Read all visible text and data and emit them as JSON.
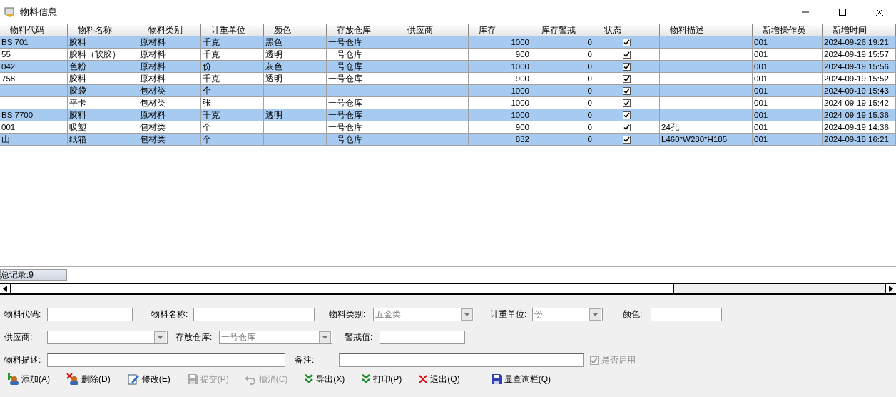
{
  "window": {
    "title": "物料信息"
  },
  "table": {
    "columns": [
      {
        "label": "物料代码",
        "kind": "text"
      },
      {
        "label": "物料名称",
        "kind": "text"
      },
      {
        "label": "物料类别",
        "kind": "text"
      },
      {
        "label": "计重单位",
        "kind": "text"
      },
      {
        "label": "颜色",
        "kind": "text"
      },
      {
        "label": "存放仓库",
        "kind": "text"
      },
      {
        "label": "供应商",
        "kind": "text"
      },
      {
        "label": "库存",
        "kind": "number"
      },
      {
        "label": "库存警戒",
        "kind": "number"
      },
      {
        "label": "状态",
        "kind": "check"
      },
      {
        "label": "物料描述",
        "kind": "text"
      },
      {
        "label": "新增操作员",
        "kind": "text"
      },
      {
        "label": "新增时间",
        "kind": "text"
      }
    ],
    "rows": [
      {
        "cells": [
          {
            "text": "BS 701"
          },
          {
            "text": "胶料"
          },
          {
            "text": "原材料"
          },
          {
            "text": "千克"
          },
          {
            "text": "黑色"
          },
          {
            "text": "一号仓库"
          },
          {},
          {
            "text": "1000"
          },
          {
            "text": "0"
          },
          {
            "checked": true
          },
          {},
          {
            "text": "001"
          },
          {
            "text": "2024-09-26 19:21"
          }
        ]
      },
      {
        "cells": [
          {
            "text": "55"
          },
          {
            "text": "胶料（软胶）"
          },
          {
            "text": "原材料"
          },
          {
            "text": "千克"
          },
          {
            "text": "透明"
          },
          {
            "text": "一号仓库"
          },
          {},
          {
            "text": "900"
          },
          {
            "text": "0"
          },
          {
            "checked": true
          },
          {},
          {
            "text": "001"
          },
          {
            "text": "2024-09-19 15:57"
          }
        ]
      },
      {
        "cells": [
          {
            "text": "042"
          },
          {
            "text": "色粉"
          },
          {
            "text": "原材料"
          },
          {
            "text": "份"
          },
          {
            "text": "灰色"
          },
          {
            "text": "一号仓库"
          },
          {},
          {
            "text": "1000"
          },
          {
            "text": "0"
          },
          {
            "checked": true
          },
          {},
          {
            "text": "001"
          },
          {
            "text": "2024-09-19 15:56"
          }
        ]
      },
      {
        "cells": [
          {
            "text": "758"
          },
          {
            "text": "胶料"
          },
          {
            "text": "原材料"
          },
          {
            "text": "千克"
          },
          {
            "text": "透明"
          },
          {
            "text": "一号仓库"
          },
          {},
          {
            "text": "900"
          },
          {
            "text": "0"
          },
          {
            "checked": true
          },
          {},
          {
            "text": "001"
          },
          {
            "text": "2024-09-19 15:52"
          }
        ]
      },
      {
        "cells": [
          {},
          {
            "text": "胶袋"
          },
          {
            "text": "包材类"
          },
          {
            "text": "个"
          },
          {},
          {},
          {},
          {
            "text": "1000"
          },
          {
            "text": "0"
          },
          {
            "checked": true
          },
          {},
          {
            "text": "001"
          },
          {
            "text": "2024-09-19 15:43"
          }
        ]
      },
      {
        "cells": [
          {},
          {
            "text": "平卡"
          },
          {
            "text": "包材类"
          },
          {
            "text": "张"
          },
          {},
          {
            "text": "一号仓库"
          },
          {},
          {
            "text": "1000"
          },
          {
            "text": "0"
          },
          {
            "checked": true
          },
          {},
          {
            "text": "001"
          },
          {
            "text": "2024-09-19 15:42"
          }
        ]
      },
      {
        "cells": [
          {
            "text": "BS 7700"
          },
          {
            "text": "胶料"
          },
          {
            "text": "原材料"
          },
          {
            "text": "千克"
          },
          {
            "text": "透明"
          },
          {
            "text": "一号仓库"
          },
          {},
          {
            "text": "1000"
          },
          {
            "text": "0"
          },
          {
            "checked": true
          },
          {},
          {
            "text": "001"
          },
          {
            "text": "2024-09-19 15:36"
          }
        ]
      },
      {
        "cells": [
          {
            "text": "001"
          },
          {
            "text": "吸塑"
          },
          {
            "text": "包材类"
          },
          {
            "text": "个"
          },
          {},
          {
            "text": "一号仓库"
          },
          {},
          {
            "text": "900"
          },
          {
            "text": "0"
          },
          {
            "checked": true
          },
          {
            "text": "24孔"
          },
          {
            "text": "001"
          },
          {
            "text": "2024-09-19 14:36"
          }
        ]
      },
      {
        "cells": [
          {
            "text": "山"
          },
          {
            "text": "纸箱"
          },
          {
            "text": "包材类"
          },
          {
            "text": "个"
          },
          {},
          {
            "text": "一号仓库"
          },
          {},
          {
            "text": "832"
          },
          {
            "text": "0"
          },
          {
            "checked": true
          },
          {
            "text": "L460*W280*H185"
          },
          {
            "text": "001"
          },
          {
            "text": "2024-09-18 16:21"
          }
        ]
      }
    ]
  },
  "status_bar": {
    "record_count": "总记录:9"
  },
  "form": {
    "fields": [
      {
        "kind": "input",
        "label": "物料代码:"
      },
      {
        "kind": "input",
        "label": "物料名称:"
      },
      {
        "kind": "select",
        "label": "物料类别:",
        "value": "五金类",
        "disabled": true
      },
      {
        "kind": "select",
        "label": "计重单位:",
        "value": "份",
        "disabled": true
      },
      {
        "kind": "input",
        "label": "颜色:"
      },
      {
        "kind": "select",
        "label": "供应商:",
        "disabled": true
      },
      {
        "kind": "select",
        "label": "存放仓库:",
        "value": "一号仓库",
        "disabled": true
      },
      {
        "kind": "input",
        "label": "警戒值:"
      },
      {
        "kind": "input",
        "label": "物料描述:"
      },
      {
        "kind": "input",
        "label": "备注:"
      },
      {
        "kind": "checkbox",
        "label": "是否启用",
        "checked": true,
        "disabled": true
      }
    ]
  },
  "toolbar": [
    {
      "kind": "add",
      "label": "添加(A)",
      "disabled": false
    },
    {
      "kind": "delete",
      "label": "删除(D)",
      "disabled": false
    },
    {
      "kind": "edit",
      "label": "修改(E)",
      "disabled": false
    },
    {
      "kind": "save",
      "label": "提交(P)",
      "disabled": true
    },
    {
      "kind": "undo",
      "label": "撤消(C)",
      "disabled": true
    },
    {
      "kind": "export",
      "label": "导出(X)",
      "disabled": false
    },
    {
      "kind": "export",
      "label": "打印(P)",
      "disabled": false
    },
    {
      "kind": "exit",
      "label": "退出(Q)",
      "disabled": false
    },
    {
      "kind": "save",
      "label": "显查询栏(Q)",
      "disabled": false
    }
  ]
}
